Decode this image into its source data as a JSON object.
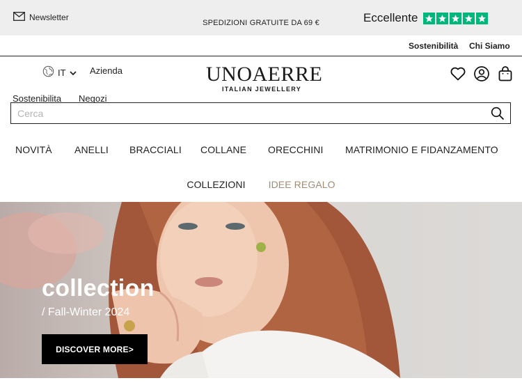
{
  "topbar": {
    "newsletter_label": "Newsletter",
    "shipping_text": "SPEDIZIONI GRATUITE DA 69 €",
    "trust_label": "Eccellente",
    "trust_color": "#00b67a",
    "stars": 5
  },
  "secondary_links": {
    "sustainability": "Sostenibilità",
    "about": "Chi Siamo"
  },
  "header": {
    "language": "IT",
    "company_link": "Azienda",
    "sustainability_link": "Sostenibilita",
    "stores_link": "Negozi",
    "logo_main": "UNOAERRE",
    "logo_sub": "ITALIAN JEWELLERY",
    "icons": [
      "heart-icon",
      "user-icon",
      "bag-icon"
    ]
  },
  "search": {
    "placeholder": "Cerca",
    "value": ""
  },
  "nav": {
    "row1": [
      "NOVITÀ",
      "ANELLI",
      "BRACCIALI",
      "COLLANE",
      "ORECCHINI",
      "MATRIMONIO E FIDANZAMENTO"
    ],
    "row2": [
      "COLLEZIONI",
      "IDEE REGALO"
    ],
    "highlight_color": "#a08c74"
  },
  "hero": {
    "title": "collection",
    "subtitle": "/ Fall-Winter 2024",
    "cta": "DISCOVER MORE>"
  }
}
